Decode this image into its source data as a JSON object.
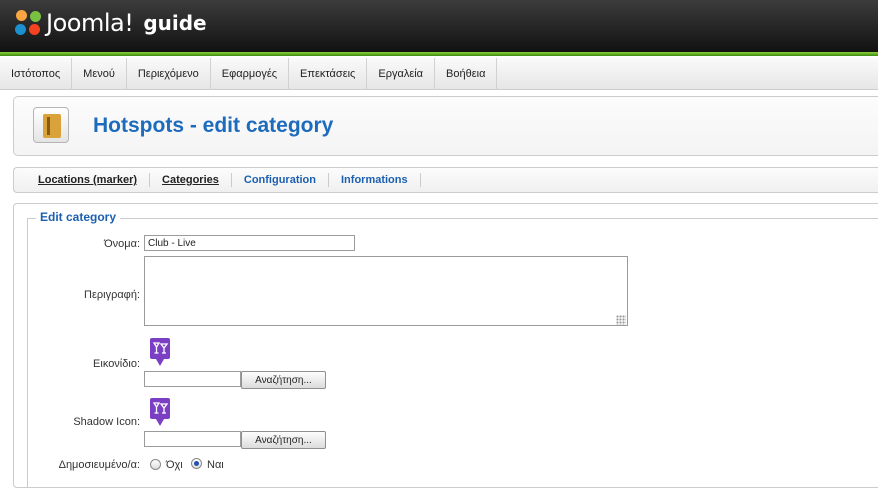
{
  "header": {
    "logo_text": "Joomla!",
    "site_name": "guide"
  },
  "menu": [
    "Ιστότοπος",
    "Μενού",
    "Περιεχόμενο",
    "Εφαρμογές",
    "Επεκτάσεις",
    "Εργαλεία",
    "Βοήθεια"
  ],
  "page_title": "Hotspots - edit category",
  "submenu": [
    "Locations (marker)",
    "Categories",
    "Configuration",
    "Informations"
  ],
  "form": {
    "legend": "Edit category",
    "name_label": "Όνομα:",
    "name_value": "Club - Live",
    "description_label": "Περιγραφή:",
    "description_value": "",
    "icon_label": "Εικονίδιο:",
    "icon_browse": "Αναζήτηση...",
    "shadow_label": "Shadow Icon:",
    "shadow_browse": "Αναζήτηση...",
    "published_label": "Δημοσιευμένο/α:",
    "option_no": "Όχι",
    "option_yes": "Ναι",
    "published_selected": "Ναι"
  },
  "colors": {
    "accent_blue": "#1d6bbd",
    "header_green": "#5fb32a",
    "marker_purple": "#7b3fc4"
  }
}
